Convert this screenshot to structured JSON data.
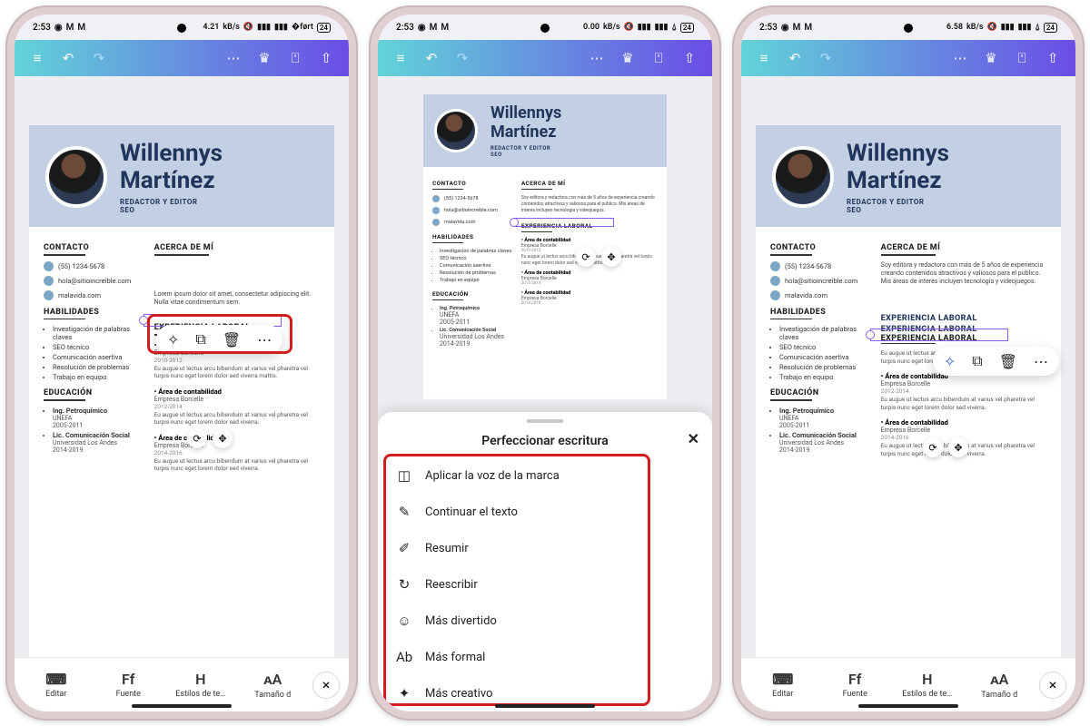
{
  "status": {
    "time": "2:53",
    "icons_left": [
      "whatsapp-icon",
      "mail-icon",
      "mail-icon"
    ],
    "kbps": [
      "4.21",
      "0.00",
      "6.58"
    ],
    "kbps_unit": "kB/s",
    "battery": "24"
  },
  "topbar_icons": [
    "hamburger-icon",
    "undo-icon",
    "redo-icon",
    "more-horizontal-icon",
    "crown-icon",
    "truck-icon",
    "share-icon"
  ],
  "resume": {
    "first_name": "Willennys",
    "last_name": "Martínez",
    "role_line": "REDACTOR Y EDITOR",
    "role_sub": "SEO",
    "contacto_h": "CONTACTO",
    "contacts": [
      "(55) 1234-5678",
      "hola@sitioincreible.com",
      "malavida.com"
    ],
    "habilidades_h": "HABILIDADES",
    "habilidades": [
      "Investigación de palabras claves",
      "SEO técnico",
      "Comunicación asertiva",
      "Resolución de problemas",
      "Trabajo en equipo"
    ],
    "educacion_h": "EDUCACIÓN",
    "educacion": [
      {
        "t": "Ing. Petroquímico",
        "s": "UNEFA",
        "d": "2005-2011"
      },
      {
        "t": "Lic. Comunicación Social",
        "s": "Universidad Los Andes",
        "d": "2014-2019"
      }
    ],
    "acerca_h": "ACERCA DE MÍ",
    "acerca": "Soy editora y redactora con más de 5 años de experiencia creando contenidos atractivos y valiosos para el público. Mis áreas de interés incluyen tecnología y videojuegos.",
    "about_lorem": "Lorem ipsum dolor sit amet, consectetur adipiscing elit. Nulla vitae condimentum sem.",
    "exp_h": "EXPERIENCIA LABORAL",
    "jobs": [
      {
        "t": "Área de contabilidad",
        "c": "Empresa Borcelle",
        "d": "2010-2012",
        "p": "Eu augue ut lectus arcu bibendum at varius vel pharetra vel turpis nunc eget lorem dolor sed viverra mattis."
      },
      {
        "t": "Área de contabilidad",
        "c": "Empresa Borcelle",
        "d": "2012-2014",
        "p": "Eu augue ut lectus arcu bibendum at varius vel pharetra vel turpis nunc eget lorem dolor sed viverra."
      },
      {
        "t": "Área de contabilidad",
        "c": "Empresa Borcelle",
        "d": "2014-2016",
        "p": "Eu augue ut lectus arcu bibendum at varius vel pharetra vel turpis nunc eget lorem dolor sed viverra."
      }
    ]
  },
  "float_tools": [
    "magic-wand-icon",
    "duplicate-icon",
    "trash-icon",
    "more-horizontal-icon"
  ],
  "handles": [
    "sync-icon",
    "move-icon"
  ],
  "bottombar": {
    "items": [
      {
        "icon": "keyboard-icon",
        "label": "Editar"
      },
      {
        "icon": "font-icon",
        "label": "Fuente",
        "glyph": "Ff"
      },
      {
        "icon": "text-style-icon",
        "label": "Estilos de te…",
        "glyph": "H"
      },
      {
        "icon": "text-size-icon",
        "label": "Tamaño d",
        "glyph": "ᴀA"
      }
    ],
    "close": "×"
  },
  "sheet": {
    "title": "Perfeccionar escritura",
    "close": "✕",
    "options": [
      {
        "icon": "brand-voice-icon",
        "glyph": "◫",
        "label": "Aplicar la voz de la marca"
      },
      {
        "icon": "continue-icon",
        "glyph": "✎",
        "label": "Continuar el texto"
      },
      {
        "icon": "summarize-icon",
        "glyph": "✐",
        "label": "Resumir"
      },
      {
        "icon": "rewrite-icon",
        "glyph": "↻",
        "label": "Reescribir"
      },
      {
        "icon": "fun-icon",
        "glyph": "☺",
        "label": "Más divertido"
      },
      {
        "icon": "formal-icon",
        "glyph": "Ab",
        "label": "Más formal"
      },
      {
        "icon": "creative-icon",
        "glyph": "✦",
        "label": "Más creativo"
      }
    ]
  }
}
